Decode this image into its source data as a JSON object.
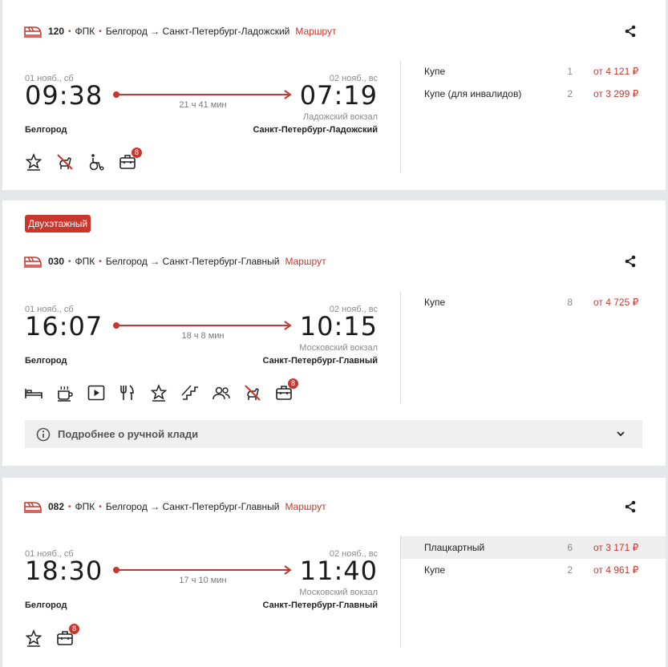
{
  "colors": {
    "accent": "#c8372d",
    "background": "#e6e7ea",
    "card": "#ffffff"
  },
  "trains": [
    {
      "badge": "",
      "number": "120",
      "carrier": "ФПК",
      "route": "Белгород → Санкт-Петербург-Ладожский",
      "route_link": "Маршрут",
      "dep_date": "01 нояб., сб",
      "arr_date": "02 нояб., вс",
      "dep_time": "09:38",
      "arr_time": "07:19",
      "duration": "21 ч 41 мин",
      "arr_station": "Ладожский вокзал",
      "dep_city": "Белгород",
      "arr_city": "Санкт-Петербург-Ладожский",
      "icons": [
        "comfort-icon",
        "no-pets-icon",
        "wheelchair-icon",
        "luggage-icon"
      ],
      "luggage_count": "8",
      "fares": [
        {
          "type": "Купе",
          "seats": "1",
          "price": "от 4 121 ₽"
        },
        {
          "type": "Купе (для инвалидов)",
          "seats": "2",
          "price": "от 3 299 ₽"
        }
      ]
    },
    {
      "badge": "Двухэтажный",
      "number": "030",
      "carrier": "ФПК",
      "route": "Белгород → Санкт-Петербург-Главный",
      "route_link": "Маршрут",
      "dep_date": "01 нояб., сб",
      "arr_date": "02 нояб., вс",
      "dep_time": "16:07",
      "arr_time": "10:15",
      "duration": "18 ч 8 мин",
      "arr_station": "Московский вокзал",
      "dep_city": "Белгород",
      "arr_city": "Санкт-Петербург-Главный",
      "icons": [
        "bed-icon",
        "coffee-icon",
        "video-icon",
        "restaurant-icon",
        "comfort-icon",
        "stairs-icon",
        "people-icon",
        "no-pets-icon",
        "luggage-icon"
      ],
      "luggage_count": "8",
      "info": "Подробнее о ручной клади",
      "fares": [
        {
          "type": "Купе",
          "seats": "8",
          "price": "от 4 725 ₽"
        }
      ]
    },
    {
      "badge": "",
      "number": "082",
      "carrier": "ФПК",
      "route": "Белгород → Санкт-Петербург-Главный",
      "route_link": "Маршрут",
      "dep_date": "01 нояб., сб",
      "arr_date": "02 нояб., вс",
      "dep_time": "18:30",
      "arr_time": "11:40",
      "duration": "17 ч 10 мин",
      "arr_station": "Московский вокзал",
      "dep_city": "Белгород",
      "arr_city": "Санкт-Петербург-Главный",
      "icons": [
        "comfort-icon",
        "luggage-icon"
      ],
      "luggage_count": "8",
      "fares": [
        {
          "type": "Плацкартный",
          "seats": "6",
          "price": "от 3 171 ₽"
        },
        {
          "type": "Купе",
          "seats": "2",
          "price": "от 4 961 ₽"
        }
      ]
    }
  ]
}
